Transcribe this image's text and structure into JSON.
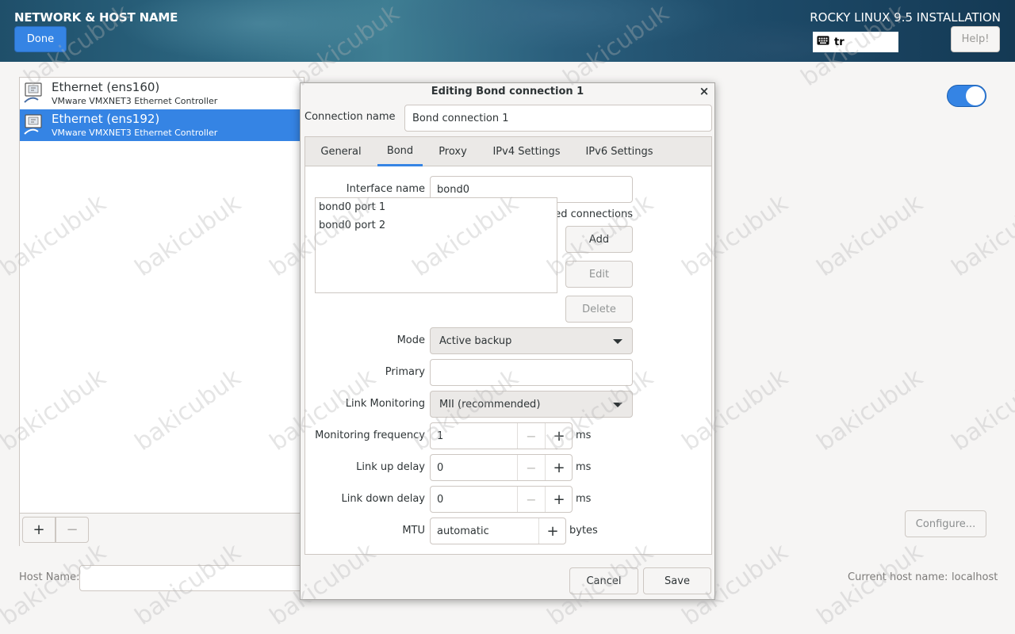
{
  "header": {
    "title": "NETWORK & HOST NAME",
    "done_label": "Done",
    "install_title": "ROCKY LINUX 9.5 INSTALLATION",
    "keyboard_layout": "tr",
    "help_label": "Help!",
    "accent": "#3584e4"
  },
  "devices": [
    {
      "name": "Ethernet (ens160)",
      "desc": "VMware VMXNET3 Ethernet Controller",
      "selected": false
    },
    {
      "name": "Ethernet (ens192)",
      "desc": "VMware VMXNET3 Ethernet Controller",
      "selected": true
    }
  ],
  "list_toolbar": {
    "add": "+",
    "remove": "−"
  },
  "host": {
    "label": "Host Name:",
    "value": "",
    "current_label": "Current host name:",
    "current_value": "localhost"
  },
  "device_panel": {
    "switch_on": true,
    "configure_label": "Configure..."
  },
  "dialog": {
    "title": "Editing Bond connection 1",
    "close": "×",
    "connection_name_label": "Connection name",
    "connection_name": "Bond connection 1",
    "tabs": [
      "General",
      "Bond",
      "Proxy",
      "IPv4 Settings",
      "IPv6 Settings"
    ],
    "active_tab": "Bond",
    "interface_name_label": "Interface name",
    "interface_name": "bond0",
    "bonded_connections_label": "Bonded connections",
    "bonded_connections": [
      "bond0 port 1",
      "bond0 port 2"
    ],
    "add_label": "Add",
    "edit_label": "Edit",
    "delete_label": "Delete",
    "mode_label": "Mode",
    "mode": "Active backup",
    "primary_label": "Primary",
    "primary": "",
    "link_monitoring_label": "Link Monitoring",
    "link_monitoring": "MII (recommended)",
    "monitoring_frequency_label": "Monitoring frequency",
    "monitoring_frequency": "1",
    "link_up_delay_label": "Link up delay",
    "link_up_delay": "0",
    "link_down_delay_label": "Link down delay",
    "link_down_delay": "0",
    "ms": "ms",
    "mtu_label": "MTU",
    "mtu": "automatic",
    "bytes": "bytes",
    "cancel_label": "Cancel",
    "save_label": "Save"
  },
  "watermark": "bakicubuk"
}
